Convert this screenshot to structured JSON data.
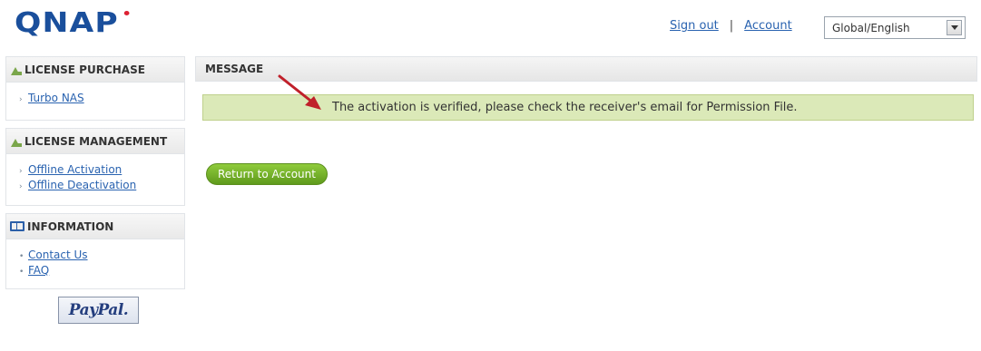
{
  "brand": {
    "logo_text": "QNAP"
  },
  "header": {
    "sign_out": "Sign out",
    "separator": "|",
    "account": "Account",
    "language": "Global/English"
  },
  "sidebar": {
    "purchase": {
      "title": "LICENSE PURCHASE",
      "items": [
        {
          "label": "Turbo NAS"
        }
      ]
    },
    "management": {
      "title": "LICENSE MANAGEMENT",
      "items": [
        {
          "label": "Offline Activation"
        },
        {
          "label": "Offline Deactivation"
        }
      ]
    },
    "information": {
      "title": "INFORMATION",
      "items": [
        {
          "label": "Contact Us"
        },
        {
          "label": "FAQ"
        }
      ]
    },
    "paypal": "PayPal."
  },
  "main": {
    "heading": "MESSAGE",
    "message": "The activation is verified, please check the receiver's email for Permission File.",
    "return_button": "Return to Account"
  },
  "colors": {
    "brand": "#1a4f9c",
    "link": "#2a63b0",
    "message_bg": "#dbe9b8",
    "button_green": "#6fae26",
    "arrow_red": "#c0202a"
  }
}
